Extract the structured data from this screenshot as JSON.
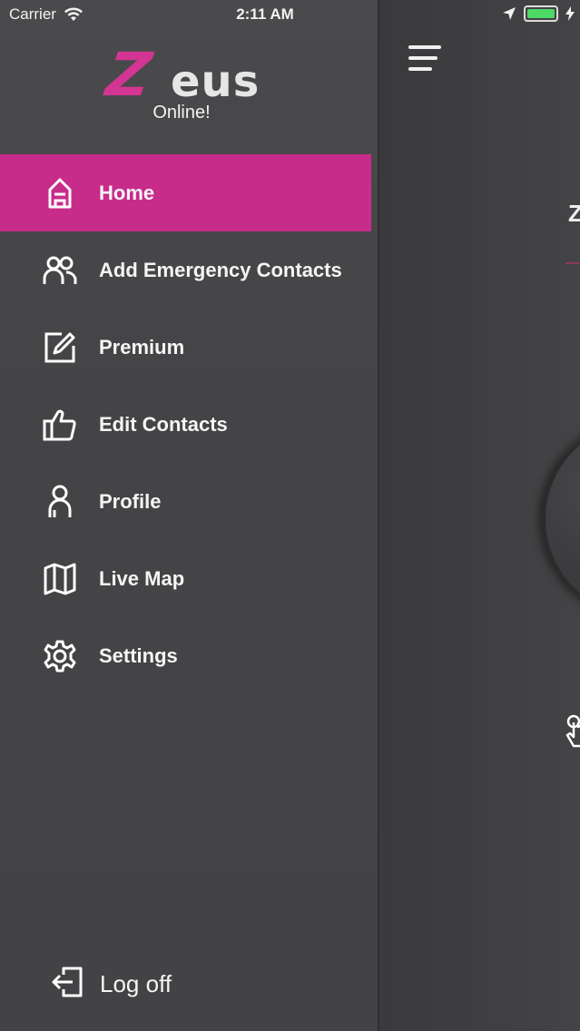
{
  "status_bar": {
    "carrier": "Carrier",
    "time": "2:11 AM"
  },
  "app": {
    "logo_first_letter": "Z",
    "logo_rest": "eus",
    "status": "Online!",
    "accent_color": "#c82c8a"
  },
  "menu": {
    "items": [
      {
        "label": "Home",
        "icon": "home-icon",
        "active": true
      },
      {
        "label": "Add Emergency Contacts",
        "icon": "people-icon",
        "active": false
      },
      {
        "label": "Premium",
        "icon": "edit-icon",
        "active": false
      },
      {
        "label": "Edit Contacts",
        "icon": "thumbs-up-icon",
        "active": false
      },
      {
        "label": "Profile",
        "icon": "person-icon",
        "active": false
      },
      {
        "label": "Live Map",
        "icon": "map-icon",
        "active": false
      },
      {
        "label": "Settings",
        "icon": "gear-icon",
        "active": false
      }
    ],
    "logoff_label": "Log off"
  },
  "main": {
    "peek_letter": "Z"
  }
}
